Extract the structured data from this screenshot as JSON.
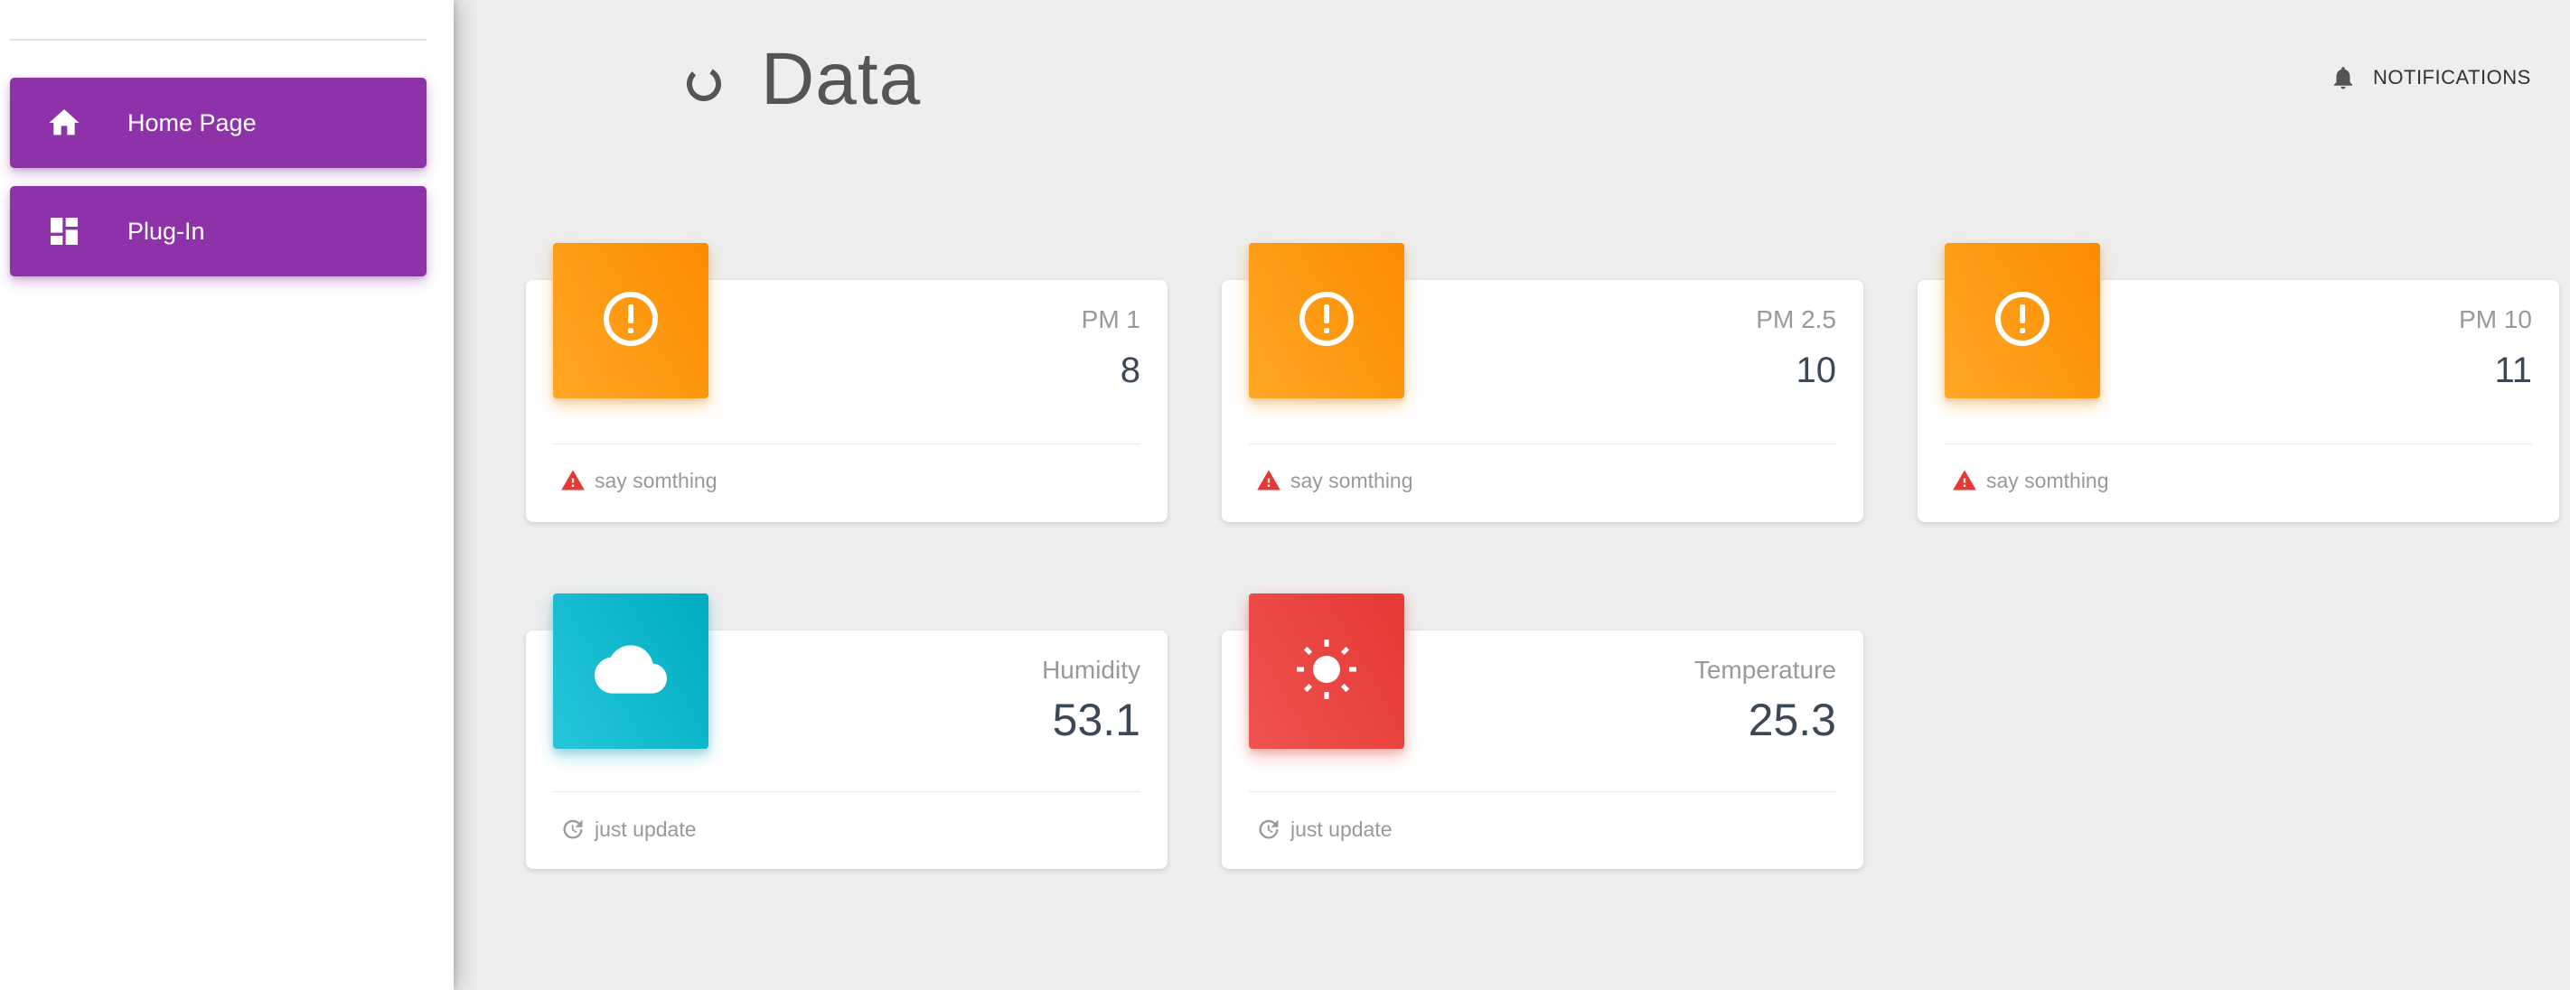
{
  "sidebar": {
    "items": [
      {
        "label": "Home Page",
        "icon": "home-icon"
      },
      {
        "label": "Plug-In",
        "icon": "dashboard-icon"
      }
    ],
    "accent_color": "#8e32a9"
  },
  "header": {
    "title": "Data",
    "title_icon": "loading-circle-icon",
    "notifications_label": "NOTIFICATIONS",
    "notifications_icon": "bell-icon"
  },
  "cards": [
    {
      "category": "PM 1",
      "value": "8",
      "footer": "say somthing",
      "icon": "alert-circle-icon",
      "footer_icon": "warning-icon",
      "color": "#fb8c00"
    },
    {
      "category": "PM 2.5",
      "value": "10",
      "footer": "say somthing",
      "icon": "alert-circle-icon",
      "footer_icon": "warning-icon",
      "color": "#fb8c00"
    },
    {
      "category": "PM 10",
      "value": "11",
      "footer": "say somthing",
      "icon": "alert-circle-icon",
      "footer_icon": "warning-icon",
      "color": "#fb8c00"
    },
    {
      "category": "Humidity",
      "value": "53.1",
      "footer": "just update",
      "icon": "cloud-icon",
      "footer_icon": "update-icon",
      "color": "#00acc1"
    },
    {
      "category": "Temperature",
      "value": "25.3",
      "footer": "just update",
      "icon": "sun-icon",
      "footer_icon": "update-icon",
      "color": "#e53935"
    }
  ],
  "colors": {
    "warning_icon": "#e53935",
    "footer_text": "#999999",
    "background": "#eeeeee"
  }
}
